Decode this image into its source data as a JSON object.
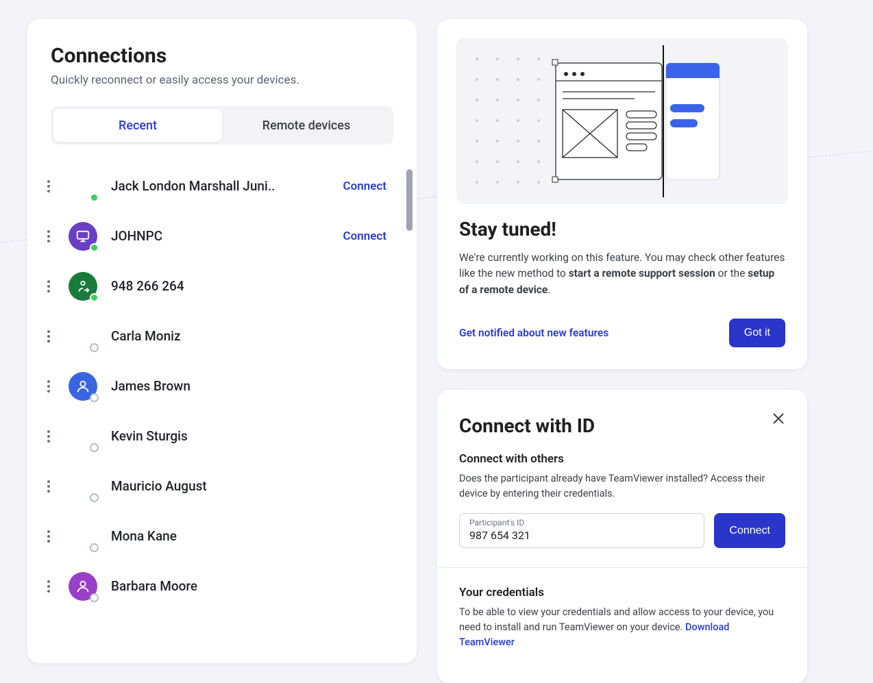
{
  "connections": {
    "title": "Connections",
    "subtitle": "Quickly reconnect or easily access your devices.",
    "tabs": {
      "recent": "Recent",
      "remote": "Remote devices"
    },
    "connect_label": "Connect",
    "items": [
      {
        "name": "Jack London Marshall Juni..",
        "avatar": "none",
        "presence": "online",
        "show_connect": true
      },
      {
        "name": "JOHNPC",
        "avatar": "monitor",
        "avatar_color": "#6a3fc6",
        "presence": "online",
        "show_connect": true
      },
      {
        "name": "948 266 264",
        "avatar": "transfer",
        "avatar_color": "#177b3a",
        "presence": "online",
        "show_connect": false
      },
      {
        "name": "Carla Moniz",
        "avatar": "none",
        "presence": "offline",
        "show_connect": false
      },
      {
        "name": "James Brown",
        "avatar": "person",
        "avatar_color": "#3a65e0",
        "presence": "offline",
        "show_connect": false
      },
      {
        "name": "Kevin Sturgis",
        "avatar": "none",
        "presence": "offline",
        "show_connect": false
      },
      {
        "name": "Mauricio August",
        "avatar": "none",
        "presence": "offline",
        "show_connect": false
      },
      {
        "name": "Mona Kane",
        "avatar": "none",
        "presence": "offline",
        "show_connect": false
      },
      {
        "name": "Barbara Moore",
        "avatar": "person",
        "avatar_color": "#9a3fc8",
        "presence": "offline",
        "show_connect": false
      }
    ]
  },
  "stay_tuned": {
    "title": "Stay tuned!",
    "body_plain": "We're currently working on this feature. You may check other features like the new method to start a remote support session or the setup of a remote device.",
    "body_pre": "We're currently working on this feature. You may check other features like the new method to ",
    "body_bold1": "start a remote support session",
    "body_mid": " or the ",
    "body_bold2": "setup of a remote device",
    "body_post": ".",
    "notify_link": "Get notified about new features",
    "got_it": "Got it"
  },
  "connect_id": {
    "title": "Connect with ID",
    "others_heading": "Connect with others",
    "others_body": "Does the participant already have TeamViewer installed? Access their device by entering their credentials.",
    "field_label": "Participant's ID",
    "field_value": "987 654 321",
    "connect_btn": "Connect",
    "creds_heading": "Your credentials",
    "creds_body": "To be able to view your credentials and allow access to your device, you need to install and run TeamViewer on your device. ",
    "download_link": "Download TeamViewer"
  }
}
